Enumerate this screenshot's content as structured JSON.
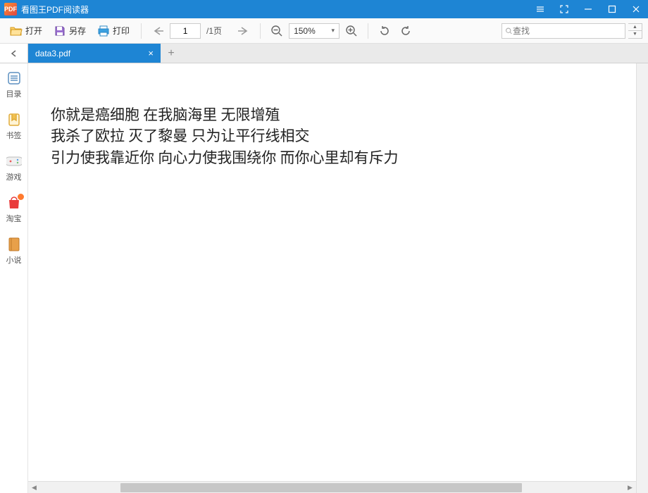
{
  "app": {
    "title": "看图王PDF阅读器",
    "logo_text": "PDF"
  },
  "toolbar": {
    "open": "打开",
    "saveas": "另存",
    "print": "打印",
    "page_current": "1",
    "page_total": "/1页",
    "zoom_value": "150%"
  },
  "search": {
    "placeholder": "查找"
  },
  "tab": {
    "filename": "data3.pdf"
  },
  "sidebar": {
    "toc": "目录",
    "bookmark": "书签",
    "game": "游戏",
    "taobao": "淘宝",
    "novel": "小说"
  },
  "document": {
    "lines": [
      "你就是癌细胞  在我脑海里  无限增殖",
      "我杀了欧拉  灭了黎曼  只为让平行线相交",
      "引力使我靠近你  向心力使我围绕你  而你心里却有斥力"
    ]
  }
}
